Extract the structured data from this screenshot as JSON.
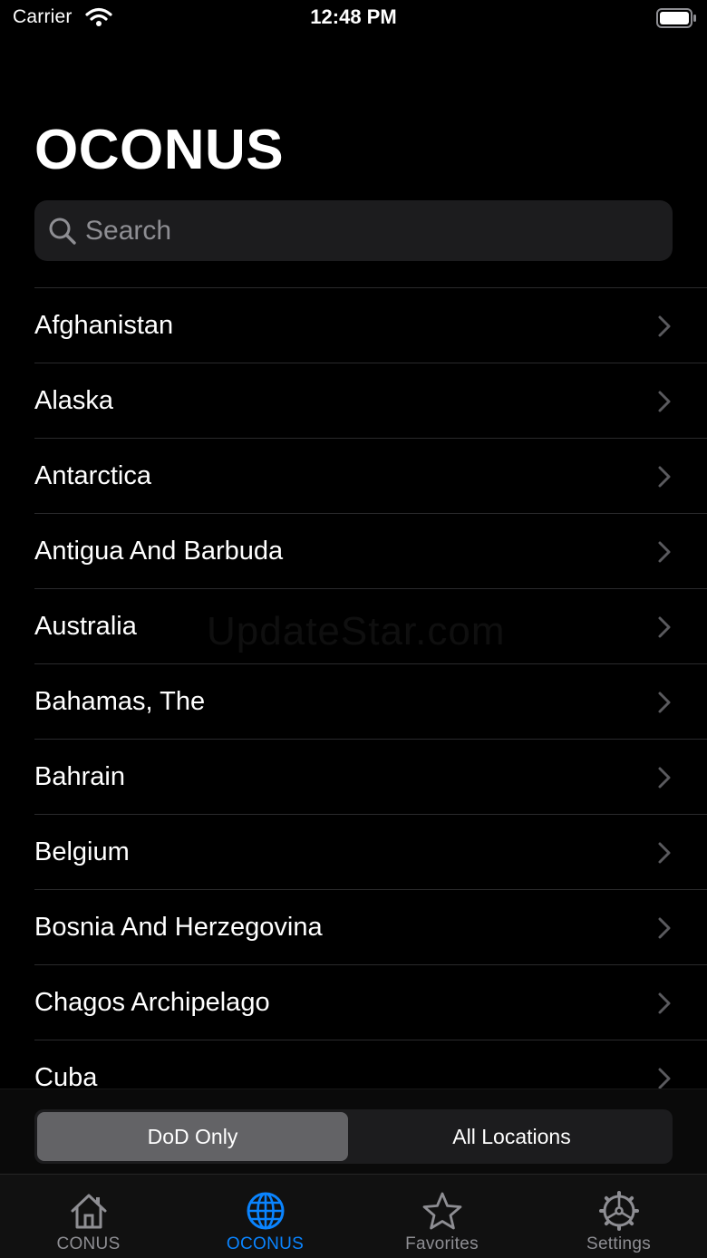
{
  "status_bar": {
    "carrier": "Carrier",
    "time": "12:48 PM"
  },
  "page": {
    "title": "OCONUS"
  },
  "search": {
    "placeholder": "Search"
  },
  "list": {
    "items": [
      {
        "label": "Afghanistan"
      },
      {
        "label": "Alaska"
      },
      {
        "label": "Antarctica"
      },
      {
        "label": "Antigua And Barbuda"
      },
      {
        "label": "Australia"
      },
      {
        "label": "Bahamas, The"
      },
      {
        "label": "Bahrain"
      },
      {
        "label": "Belgium"
      },
      {
        "label": "Bosnia And Herzegovina"
      },
      {
        "label": "Chagos Archipelago"
      },
      {
        "label": "Cuba"
      }
    ]
  },
  "watermark": "UpdateStar.com",
  "filter": {
    "options": [
      {
        "label": "DoD Only"
      },
      {
        "label": "All Locations"
      }
    ],
    "selected": "DoD Only"
  },
  "tabs": [
    {
      "label": "CONUS",
      "icon": "house-icon"
    },
    {
      "label": "OCONUS",
      "icon": "globe-icon"
    },
    {
      "label": "Favorites",
      "icon": "star-icon"
    },
    {
      "label": "Settings",
      "icon": "gear-icon"
    }
  ],
  "active_tab": "OCONUS",
  "colors": {
    "background": "#000000",
    "accent": "#0a84ff",
    "inactive": "#8e8e93",
    "separator": "#2a2a2c"
  }
}
